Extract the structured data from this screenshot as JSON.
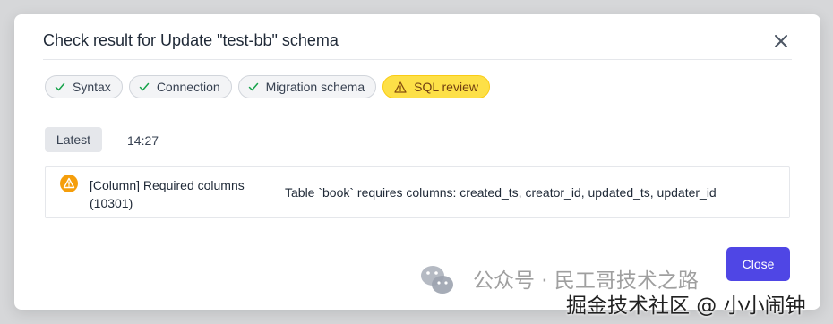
{
  "dialog": {
    "title": "Check result for Update \"test-bb\" schema",
    "close_icon": "close-icon"
  },
  "checks": [
    {
      "label": "Syntax",
      "status": "success",
      "icon": "check-icon"
    },
    {
      "label": "Connection",
      "status": "success",
      "icon": "check-icon"
    },
    {
      "label": "Migration schema",
      "status": "success",
      "icon": "check-icon"
    },
    {
      "label": "SQL review",
      "status": "warning",
      "icon": "warning-icon"
    }
  ],
  "history": {
    "latest_label": "Latest",
    "time": "14:27"
  },
  "result": {
    "rule": "[Column] Required columns (10301)",
    "message": "Table `book` requires columns: created_ts, creator_id, updated_ts, updater_id"
  },
  "footer": {
    "close_label": "Close"
  },
  "watermark": {
    "line1": "公众号 · 民工哥技术之路",
    "line2": "掘金技术社区 @ 小小闹钟"
  },
  "colors": {
    "accent": "#4f46e5",
    "warning_chip": "#fde047",
    "success_check": "#16a34a",
    "warning_icon": "#f59e0b"
  }
}
